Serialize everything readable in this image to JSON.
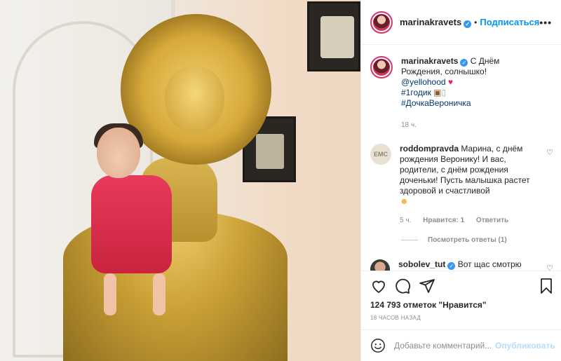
{
  "post_author": {
    "username": "marinakravets",
    "follow_label": "Подписаться",
    "separator": "•"
  },
  "caption": {
    "username": "marinakravets",
    "text": "С Днём Рождения, солнышко!",
    "mention": "@yellohood",
    "hashtag1": "#1годик",
    "hashtag2": "#ДочкаВероничка",
    "time": "18 ч."
  },
  "comments": [
    {
      "username": "roddompravda",
      "avatar_text": "EMC",
      "text": "Марина, с днём рождения Веронику! И вас, родители, с днём рождения доченьки! Пусть малышка растет здоровой и счастливой",
      "time": "5 ч.",
      "likes": "Нравится: 1",
      "reply": "Ответить",
      "view_replies": "Посмотреть ответы (1)"
    },
    {
      "username": "sobolev_tut",
      "text": "Вот щас смотрю"
    }
  ],
  "stats": {
    "likes": "124 793 отметок \"Нравится\"",
    "time": "18 часов назад"
  },
  "comment_box": {
    "placeholder": "Добавьте комментарий...",
    "publish": "Опубликовать"
  },
  "colors": {
    "accent": "#0095f6",
    "verified": "#3897f0",
    "story_ring": "#e1306c"
  },
  "icons": [
    "heart-icon",
    "comment-icon",
    "share-icon",
    "bookmark-icon",
    "more-icon",
    "smile-icon",
    "verified-icon"
  ]
}
